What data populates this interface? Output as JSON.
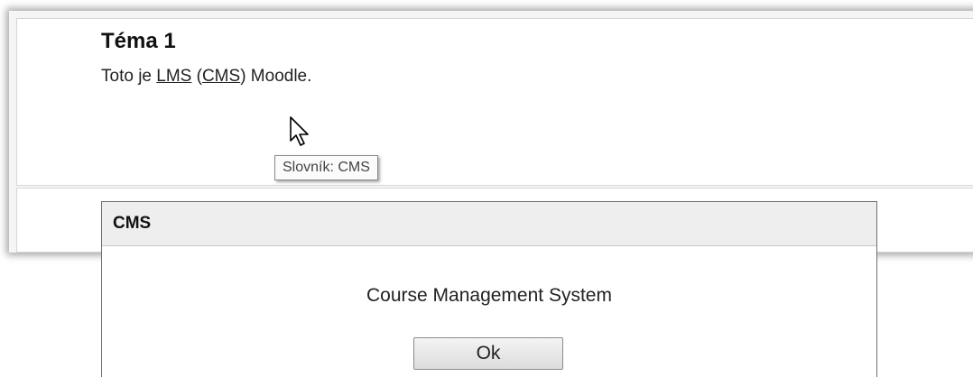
{
  "section": {
    "title": "Téma 1",
    "text_prefix": "Toto je ",
    "link_lms": "LMS",
    "text_open_paren": " (",
    "link_cms": "CMS",
    "text_suffix": ") Moodle."
  },
  "tooltip": {
    "text": "Slovník: CMS"
  },
  "dialog": {
    "title": "CMS",
    "message": "Course Management System",
    "ok_label": "Ok"
  },
  "icons": {
    "cursor": "mouse-pointer-icon"
  }
}
